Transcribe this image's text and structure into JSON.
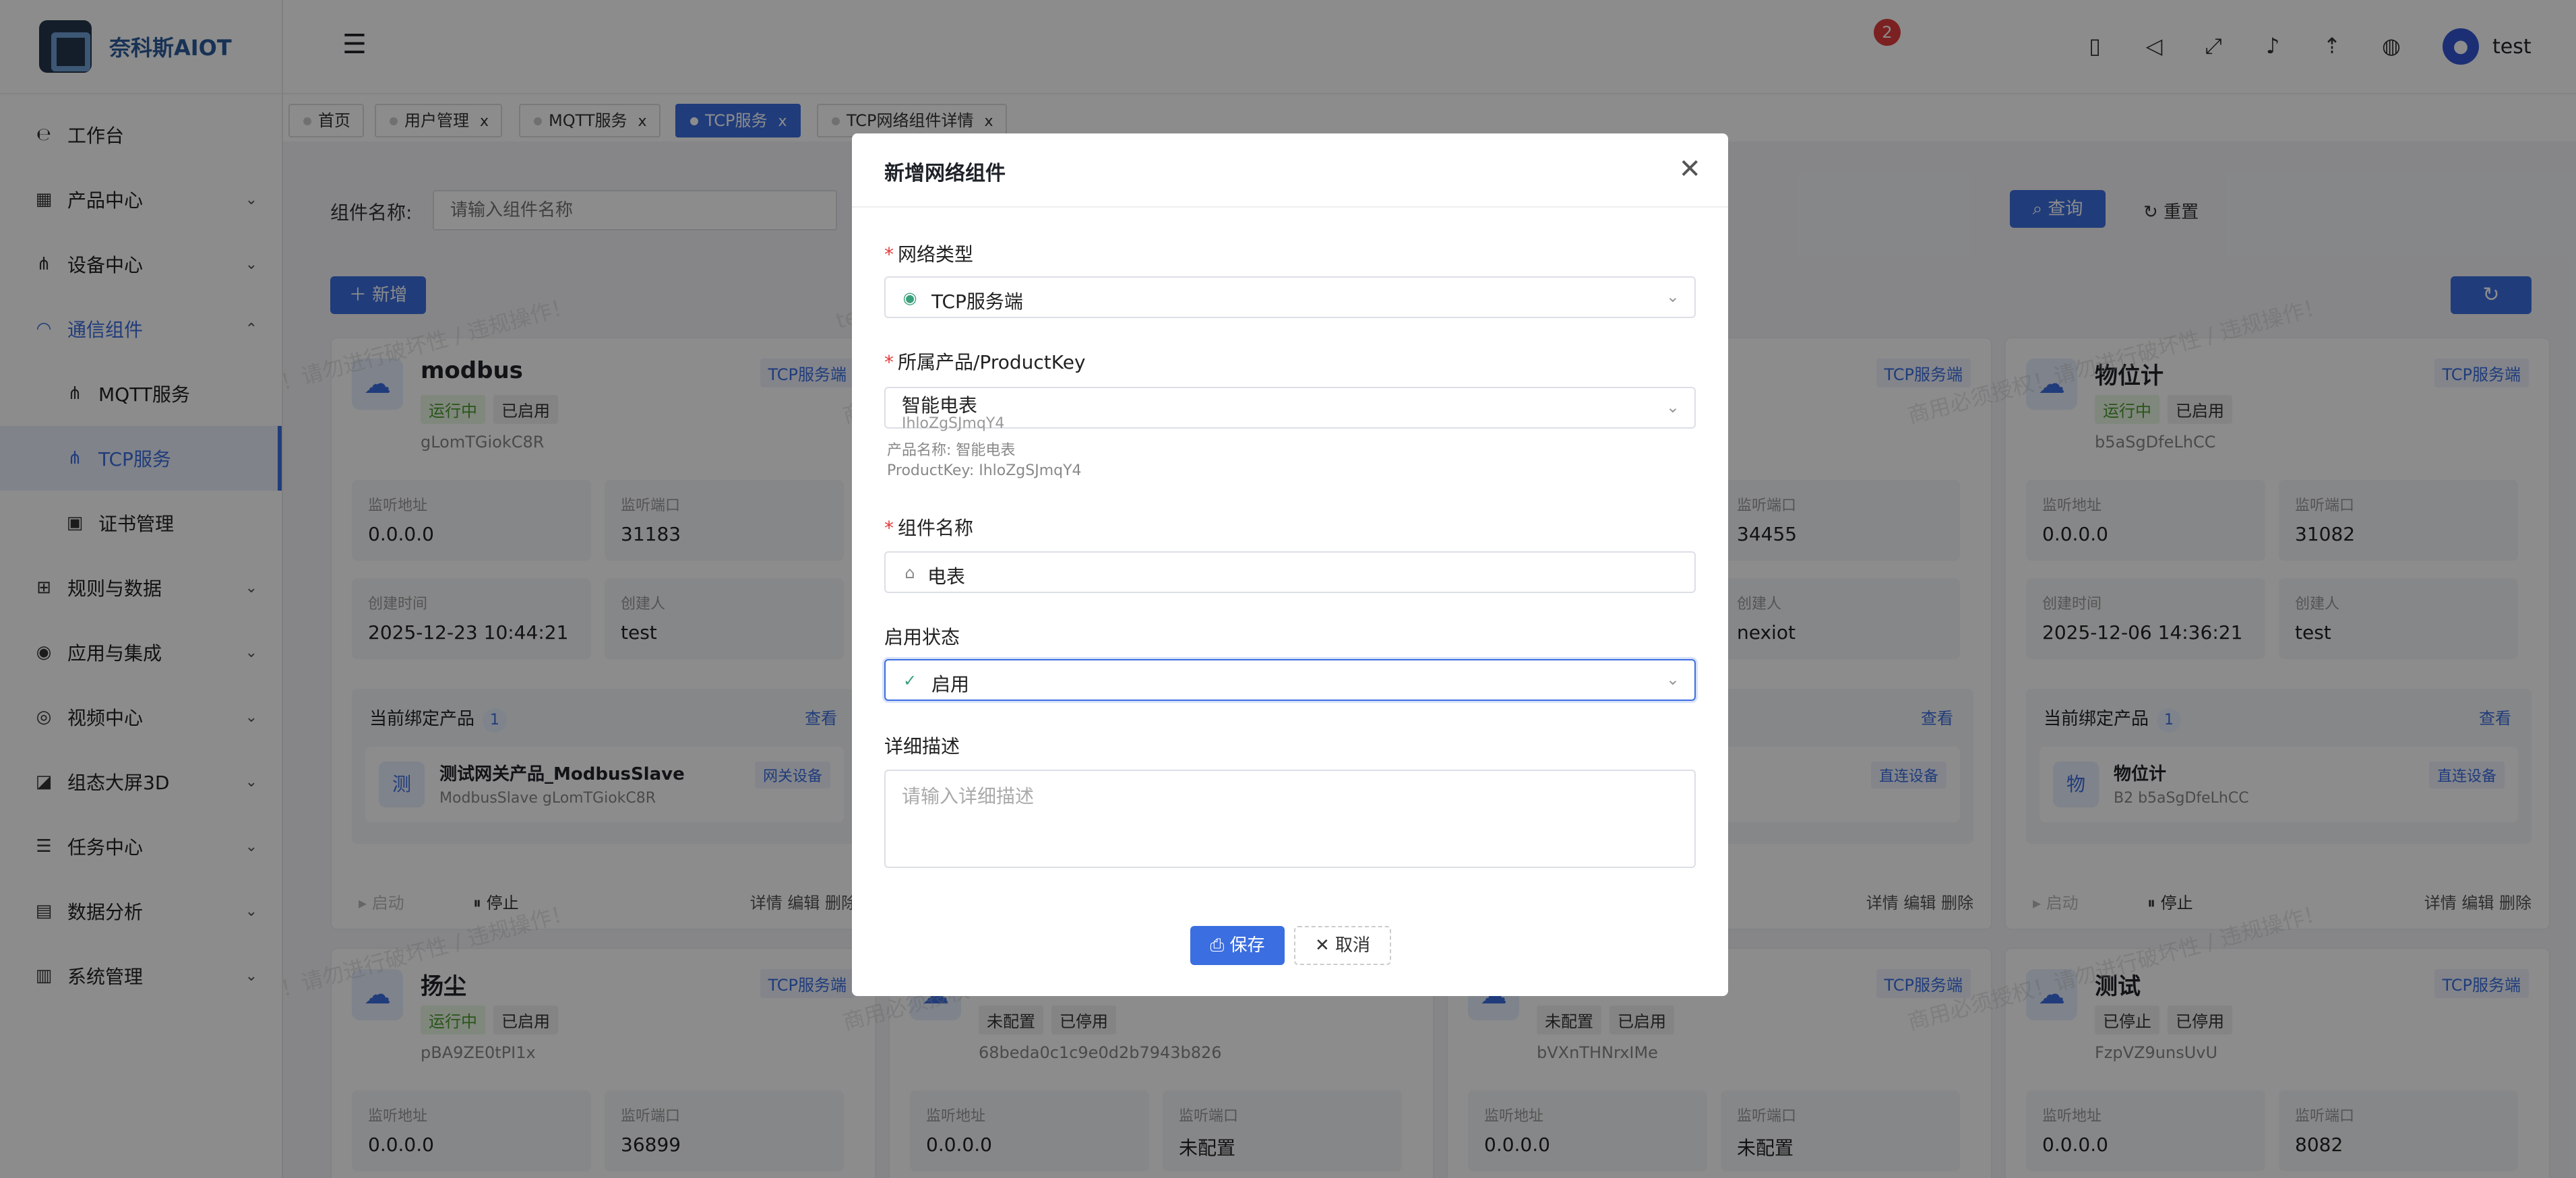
{
  "app": {
    "logo_text": "奈科斯AIOT",
    "user": "test",
    "notification_count": "2"
  },
  "sidebar": {
    "items": [
      {
        "label": "工作台",
        "icon": "workbench-icon"
      },
      {
        "label": "产品中心",
        "icon": "product-icon"
      },
      {
        "label": "设备中心",
        "icon": "device-icon"
      },
      {
        "label": "通信组件",
        "icon": "wifi-icon"
      },
      {
        "label": "MQTT服务",
        "icon": "mqtt-icon"
      },
      {
        "label": "TCP服务",
        "icon": "tcp-icon"
      },
      {
        "label": "证书管理",
        "icon": "cert-icon"
      },
      {
        "label": "规则与数据",
        "icon": "rules-icon"
      },
      {
        "label": "应用与集成",
        "icon": "app-icon"
      },
      {
        "label": "视频中心",
        "icon": "video-icon"
      },
      {
        "label": "组态大屏3D",
        "icon": "dashboard-icon"
      },
      {
        "label": "任务中心",
        "icon": "task-icon"
      },
      {
        "label": "数据分析",
        "icon": "analytics-icon"
      },
      {
        "label": "系统管理",
        "icon": "system-icon"
      }
    ]
  },
  "tabs": [
    {
      "label": "首页"
    },
    {
      "label": "用户管理"
    },
    {
      "label": "MQTT服务"
    },
    {
      "label": "TCP服务"
    },
    {
      "label": "TCP网络组件详情"
    }
  ],
  "filter": {
    "label": "组件名称:",
    "placeholder": "请输入组件名称",
    "query": "查询",
    "reset": "重置",
    "add": "新增"
  },
  "cards": [
    {
      "name": "modbus",
      "type": "TCP服务端",
      "status": "运行中",
      "enabled": "已启用",
      "key": "gLomTGiokC8R",
      "addr_label": "监听地址",
      "addr": "0.0.0.0",
      "port_label": "监听端口",
      "port": "31183",
      "time_label": "创建时间",
      "time": "2025-12-23 10:44:21",
      "creator_label": "创建人",
      "creator": "test",
      "bind_title": "当前绑定产品",
      "bind_count": "1",
      "bind_view": "查看",
      "bind_icon": "测",
      "bind_name": "测试网关产品_ModbusSlave",
      "bind_sub": "ModbusSlave gLomTGiokC8R",
      "bind_tag": "网关设备",
      "start": "启动",
      "stop": "停止",
      "ops": "详情  编辑  删除"
    },
    {
      "name": "物位计",
      "type": "TCP服务端",
      "status": "运行中",
      "enabled": "已启用",
      "key": "b5aSgDfeLhCC",
      "addr_label": "监听地址",
      "addr": "0.0.0.0",
      "port_label": "监听端口",
      "port": "31082",
      "time_label": "创建时间",
      "time": "2025-12-06 14:36:21",
      "creator_label": "创建人",
      "creator": "test",
      "bind_title": "当前绑定产品",
      "bind_count": "1",
      "bind_view": "查看",
      "bind_icon": "物",
      "bind_name": "物位计",
      "bind_sub": "B2  b5aSgDfeLhCC",
      "bind_tag": "直连设备",
      "start": "启动",
      "stop": "停止",
      "ops": "详情  编辑  删除"
    },
    {
      "type": "TCP服务端",
      "port_label": "监听端口",
      "port": "34455",
      "creator_label": "创建人",
      "creator": "nexiot",
      "bind_view": "查看",
      "bind_tag": "直连设备",
      "ops": "详情  编辑  删除"
    },
    {
      "name": "扬尘",
      "type": "TCP服务端",
      "status": "运行中",
      "enabled": "已启用",
      "key": "pBA9ZE0tPI1x",
      "addr_label": "监听地址",
      "addr": "0.0.0.0",
      "port_label": "监听端口",
      "port": "36899"
    },
    {
      "status": "未配置",
      "enabled": "已停用",
      "key": "68beda0c1c9e0d2b7943b826",
      "addr_label": "监听地址",
      "addr": "0.0.0.0",
      "port_label": "监听端口",
      "port": "未配置"
    },
    {
      "type": "TCP服务端",
      "status": "未配置",
      "enabled": "已启用",
      "key": "bVXnTHNrxIMe",
      "addr_label": "监听地址",
      "addr": "0.0.0.0",
      "port_label": "监听端口",
      "port": "未配置"
    },
    {
      "name": "测试",
      "type": "TCP服务端",
      "status": "已停止",
      "enabled": "已停用",
      "key": "FzpVZ9unsUvU",
      "addr_label": "监听地址",
      "addr": "0.0.0.0",
      "port_label": "监听端口",
      "port": "8082"
    }
  ],
  "watermark": "商用必须授权！请勿进行破坏性 / 违规操作！",
  "watermark_user": "test",
  "modal": {
    "title": "新增网络组件",
    "network_type_label": "网络类型",
    "network_type_value": "TCP服务端",
    "product_label": "所属产品/ProductKey",
    "product_value": "智能电表",
    "product_key": "IhloZgSJmqY4",
    "product_hint_name": "产品名称: 智能电表",
    "product_hint_key": "ProductKey: IhloZgSJmqY4",
    "component_name_label": "组件名称",
    "component_name_value": "电表",
    "enable_label": "启用状态",
    "enable_value": "启用",
    "desc_label": "详细描述",
    "desc_placeholder": "请输入详细描述",
    "save": "保存",
    "cancel": "取消"
  },
  "colors": {
    "primary": "#3b6ee0",
    "overlay": "rgba(0,0,0,0.45)",
    "running": "#4a9b2d",
    "required": "#e23c3c"
  }
}
